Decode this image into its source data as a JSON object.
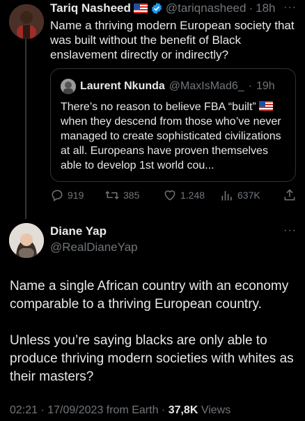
{
  "parent": {
    "author_name": "Tariq Nasheed",
    "handle": "@tariqnasheed",
    "dot": "·",
    "age": "18h",
    "text": "Name a thriving modern European society that was built without the benefit of Black enslavement directly or indirectly?",
    "more": "···"
  },
  "quote": {
    "author_name": "Laurent Nkunda",
    "handle": "@MaxIsMad6_",
    "dot": "·",
    "age": "19h",
    "text_before_flag": "There’s no reason to believe FBA “built”",
    "text_after_flag": "when they descend from those who’ve never managed to create sophisticated civilizations at all. Europeans have proven themselves able to develop 1st world cou..."
  },
  "actions": {
    "replies": "919",
    "reposts": "385",
    "likes": "1.248",
    "views": "637K"
  },
  "reply": {
    "author_name": "Diane Yap",
    "handle": "@RealDianeYap",
    "more": "···",
    "paragraph1": "Name a single African country with an economy comparable to a thriving European country.",
    "paragraph2": "Unless you’re saying blacks are only able to produce thriving modern societies with whites as their masters?",
    "timestamp": "02:21 · 17/09/2023 from Earth · ",
    "views_count": "37,8K",
    "views_label": " Views"
  },
  "colors": {
    "background": "#000000",
    "text": "#e7e9ea",
    "muted": "#71767b",
    "border": "#2f3336",
    "verified": "#1d9bf0"
  },
  "icons": [
    "flag-us-icon",
    "verified-badge-icon",
    "reply-icon",
    "repost-icon",
    "like-icon",
    "views-icon",
    "share-icon",
    "more-icon"
  ]
}
